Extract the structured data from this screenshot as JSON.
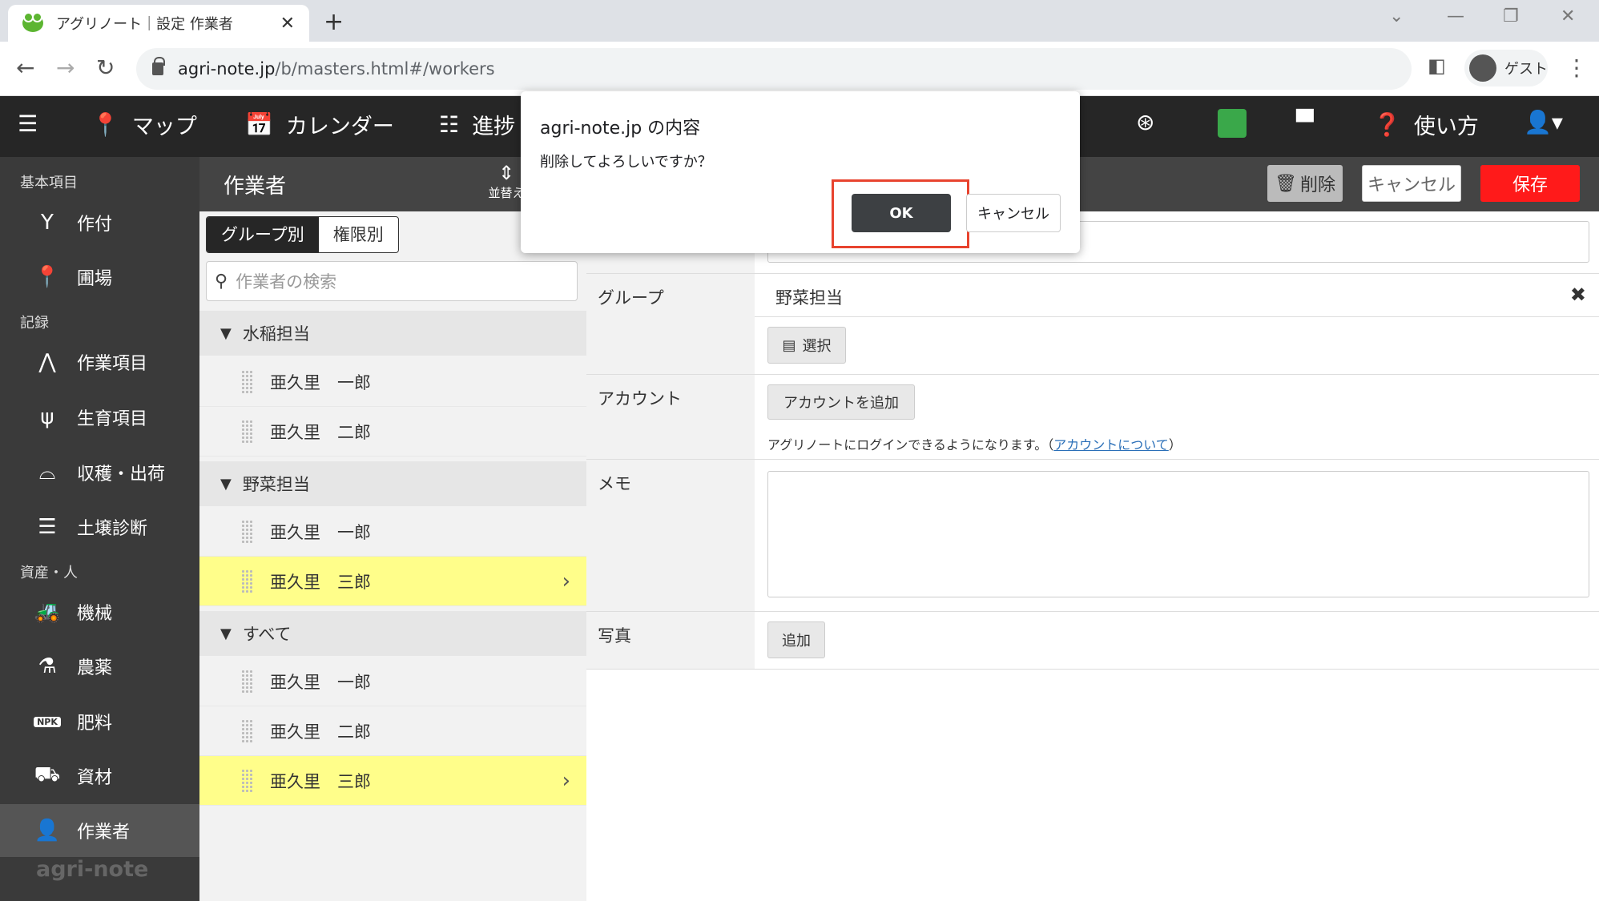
{
  "browser": {
    "tab_title": "アグリノート｜設定 作業者",
    "tab_close": "✕",
    "new_tab": "+",
    "url_domain": "agri-note.jp",
    "url_path": "/b/masters.html#/workers",
    "profile_label": "ゲスト"
  },
  "header": {
    "map": "マップ",
    "calendar": "カレンダー",
    "progress": "進捗",
    "help": "使い方"
  },
  "sidebar": {
    "sections": [
      "基本項目",
      "記録",
      "資産・人"
    ],
    "items": [
      {
        "label": "作付",
        "icon": "sprout-icon"
      },
      {
        "label": "圃場",
        "icon": "map-pin-icon"
      },
      {
        "label": "作業項目",
        "icon": "task-icon"
      },
      {
        "label": "生育項目",
        "icon": "growth-icon"
      },
      {
        "label": "収穫・出荷",
        "icon": "basket-icon"
      },
      {
        "label": "土壌診断",
        "icon": "sliders-icon"
      },
      {
        "label": "機械",
        "icon": "tractor-icon"
      },
      {
        "label": "農薬",
        "icon": "flask-icon"
      },
      {
        "label": "肥料",
        "icon": "npk-icon"
      },
      {
        "label": "資材",
        "icon": "wheelbarrow-icon"
      },
      {
        "label": "作業者",
        "icon": "person-icon"
      }
    ],
    "brand": "agri-note"
  },
  "list": {
    "title": "作業者",
    "sort_label": "並替え",
    "segments": [
      "グループ別",
      "権限別"
    ],
    "search_placeholder": "作業者の検索",
    "groups": [
      {
        "name": "水稲担当",
        "members": [
          "亜久里　一郎",
          "亜久里　二郎"
        ]
      },
      {
        "name": "野菜担当",
        "members": [
          "亜久里　一郎",
          "亜久里　三郎"
        ]
      },
      {
        "name": "すべて",
        "members": [
          "亜久里　一郎",
          "亜久里　二郎",
          "亜久里　三郎"
        ]
      }
    ]
  },
  "toolbar": {
    "delete": "削除",
    "cancel": "キャンセル",
    "save": "保存"
  },
  "detail": {
    "group_label": "グループ",
    "group_value": "野菜担当",
    "select_button": "選択",
    "account_label": "アカウント",
    "add_account_button": "アカウントを追加",
    "account_note_prefix": "アグリノートにログインできるようになります。（",
    "account_note_link": "アカウントについて",
    "account_note_suffix": "）",
    "memo_label": "メモ",
    "photo_label": "写真",
    "add_photo_button": "追加"
  },
  "dialog": {
    "title": "agri-note.jp の内容",
    "message": "削除してよろしいですか？",
    "ok": "OK",
    "cancel": "キャンセル"
  },
  "colors": {
    "header_bg": "#262626",
    "sidebar_bg": "#3a3a3a",
    "selected_row": "#fffe8a",
    "save_button": "#ff1a1a",
    "highlight_box": "#e8432e"
  }
}
